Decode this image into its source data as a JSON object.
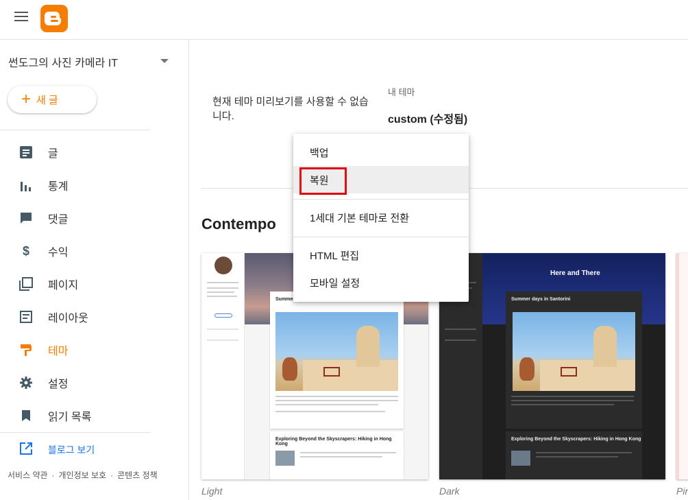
{
  "blog": {
    "title": "썬도그의 사진 카메라 IT"
  },
  "new_post": {
    "label": "새 글"
  },
  "nav": [
    {
      "label": "글",
      "icon": "posts-icon",
      "active": false
    },
    {
      "label": "통계",
      "icon": "stats-icon",
      "active": false
    },
    {
      "label": "댓글",
      "icon": "comments-icon",
      "active": false
    },
    {
      "label": "수익",
      "icon": "dollar-icon",
      "active": false
    },
    {
      "label": "페이지",
      "icon": "pages-icon",
      "active": false
    },
    {
      "label": "레이아웃",
      "icon": "layout-icon",
      "active": false
    },
    {
      "label": "테마",
      "icon": "paint-roller-icon",
      "active": true
    },
    {
      "label": "설정",
      "icon": "gear-icon",
      "active": false
    },
    {
      "label": "읽기 목록",
      "icon": "bookmark-icon",
      "active": false
    }
  ],
  "view_blog": {
    "label": "블로그 보기"
  },
  "footer": {
    "terms": "서비스 약관",
    "privacy": "개인정보 보호",
    "content_policy": "콘텐츠 정책"
  },
  "main": {
    "preview_unavailable": "현재 테마 미리보기를 사용할 수 없습니다.",
    "my_theme_label": "내 테마",
    "my_theme_name": "custom (수정됨)",
    "section_title": "Contempo"
  },
  "themes": [
    {
      "label": "Light"
    },
    {
      "label": "Dark",
      "hero_title": "Here and There"
    },
    {
      "label": "Pir"
    }
  ],
  "previews": {
    "post1_title": "Summer days in Santorini",
    "post1_title_short": "Summer",
    "post2_title": "Exploring Beyond the Skyscrapers: Hiking in Hong Kong"
  },
  "menu": {
    "items": [
      "백업",
      "복원",
      "1세대 기본 테마로 전환",
      "HTML 편집",
      "모바일 설정"
    ],
    "highlighted": "복원"
  },
  "colors": {
    "accent": "#f57d00",
    "highlight_box": "#e00000",
    "link": "#1a73e8"
  }
}
